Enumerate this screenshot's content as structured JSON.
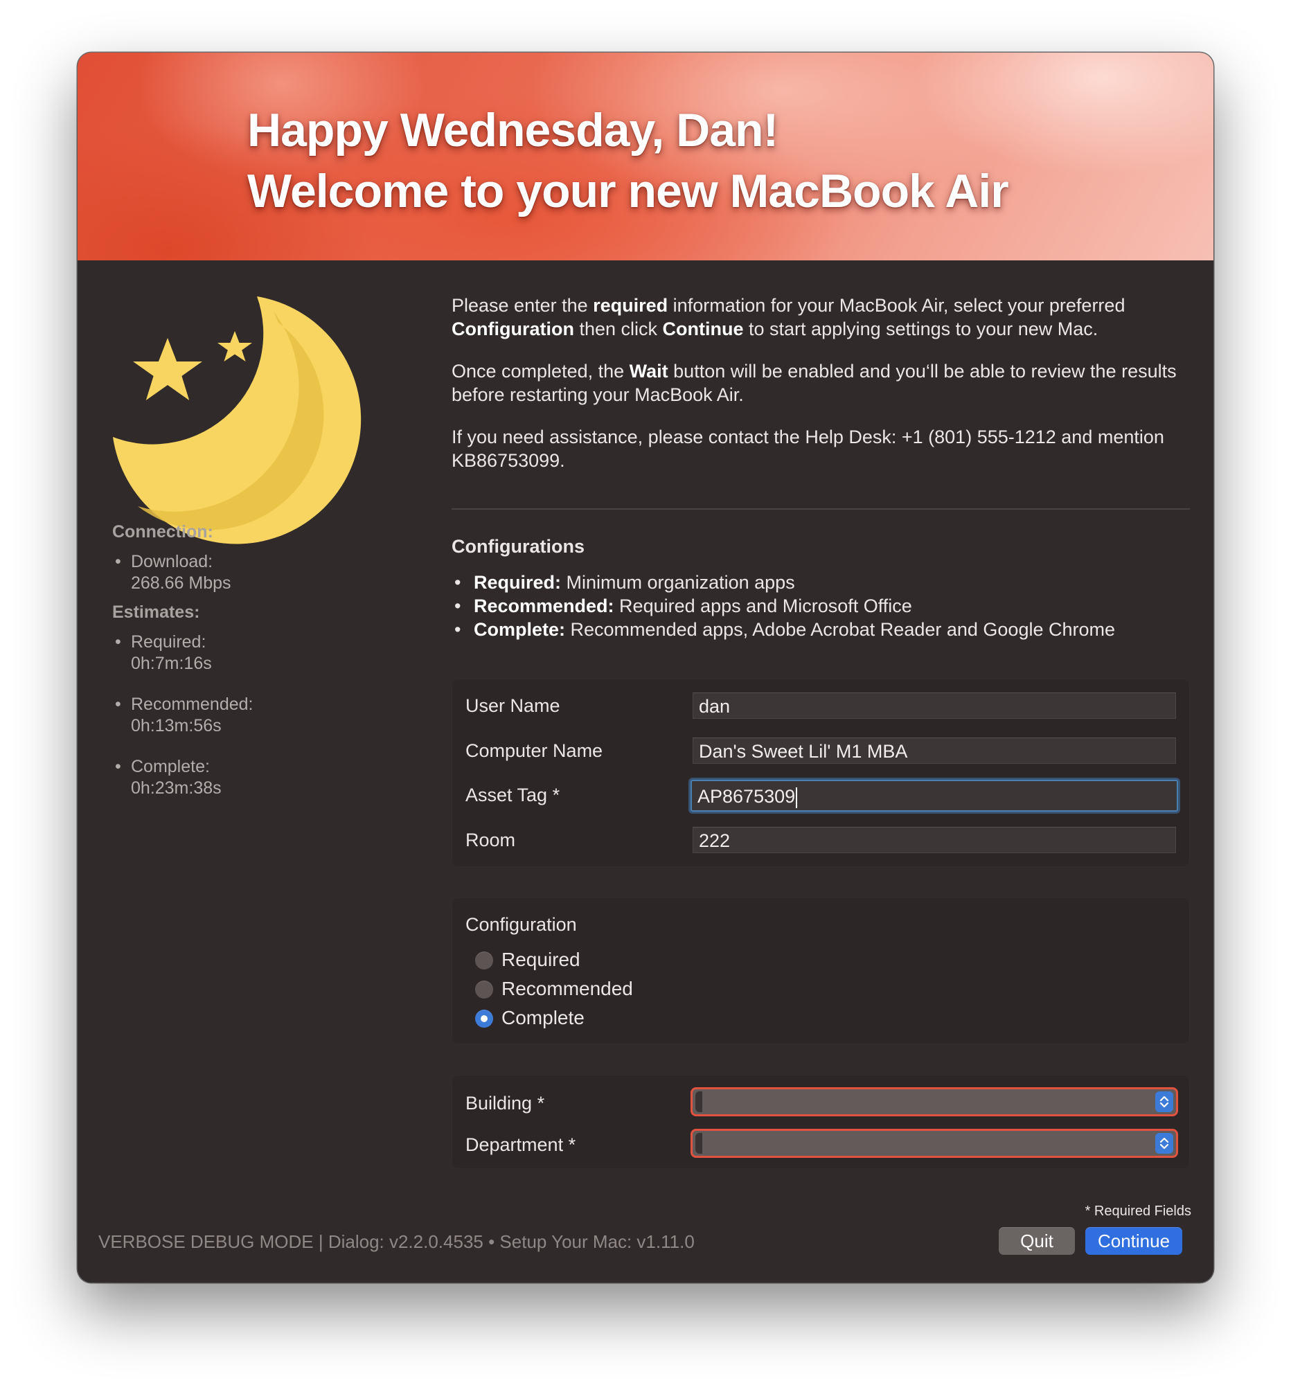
{
  "banner": {
    "line1": "Happy Wednesday, Dan!",
    "line2": "Welcome to your new MacBook Air"
  },
  "sidebar": {
    "icon": "moon-and-stars-icon",
    "connection_heading": "Connection:",
    "download_label": "Download:",
    "download_value": "268.66 Mbps",
    "estimates_heading": "Estimates:",
    "estimates": [
      {
        "label": "Required:",
        "value": "0h:7m:16s"
      },
      {
        "label": "Recommended:",
        "value": "0h:13m:56s"
      },
      {
        "label": "Complete:",
        "value": "0h:23m:38s"
      }
    ]
  },
  "message": {
    "p1": {
      "t1": "Please enter the ",
      "b1": "required",
      "t2": " information for your MacBook Air, select your preferred ",
      "b2": "Configuration",
      "t3": " then click ",
      "b3": "Continue",
      "t4": " to start applying settings to your new Mac."
    },
    "p2": {
      "t1": "Once completed, the ",
      "b1": "Wait",
      "t2": " button will be enabled and you‘ll be able to review the results before restarting your MacBook Air."
    },
    "p3": "If you need assistance, please contact the Help Desk: +1 (801) 555-1212 and mention KB86753099."
  },
  "configurations": {
    "heading": "Configurations",
    "items": [
      {
        "name": "Required:",
        "desc": " Minimum organization apps"
      },
      {
        "name": "Recommended:",
        "desc": " Required apps and Microsoft Office"
      },
      {
        "name": "Complete:",
        "desc": " Recommended apps, Adobe Acrobat Reader and Google Chrome"
      }
    ]
  },
  "fields": [
    {
      "label": "User Name",
      "value": "dan"
    },
    {
      "label": "Computer Name",
      "value": "Dan's Sweet Lil' M1 MBA"
    },
    {
      "label": "Asset Tag *",
      "value": "AP8675309"
    },
    {
      "label": "Room",
      "value": "222"
    }
  ],
  "configuration_radio": {
    "label": "Configuration",
    "options": [
      "Required",
      "Recommended",
      "Complete"
    ],
    "selected": "Complete"
  },
  "selects": [
    {
      "label": "Building *",
      "value": ""
    },
    {
      "label": "Department *",
      "value": ""
    }
  ],
  "required_note": "* Required Fields",
  "footer": "VERBOSE DEBUG MODE | Dialog: v2.2.0.4535 • Setup Your Mac: v1.11.0",
  "buttons": {
    "quit": "Quit",
    "continue": "Continue"
  },
  "colors": {
    "window_bg": "#302a2a",
    "accent_blue": "#2f6fe0",
    "error_red": "#e2533f",
    "moon_yellow": "#f7d560"
  }
}
